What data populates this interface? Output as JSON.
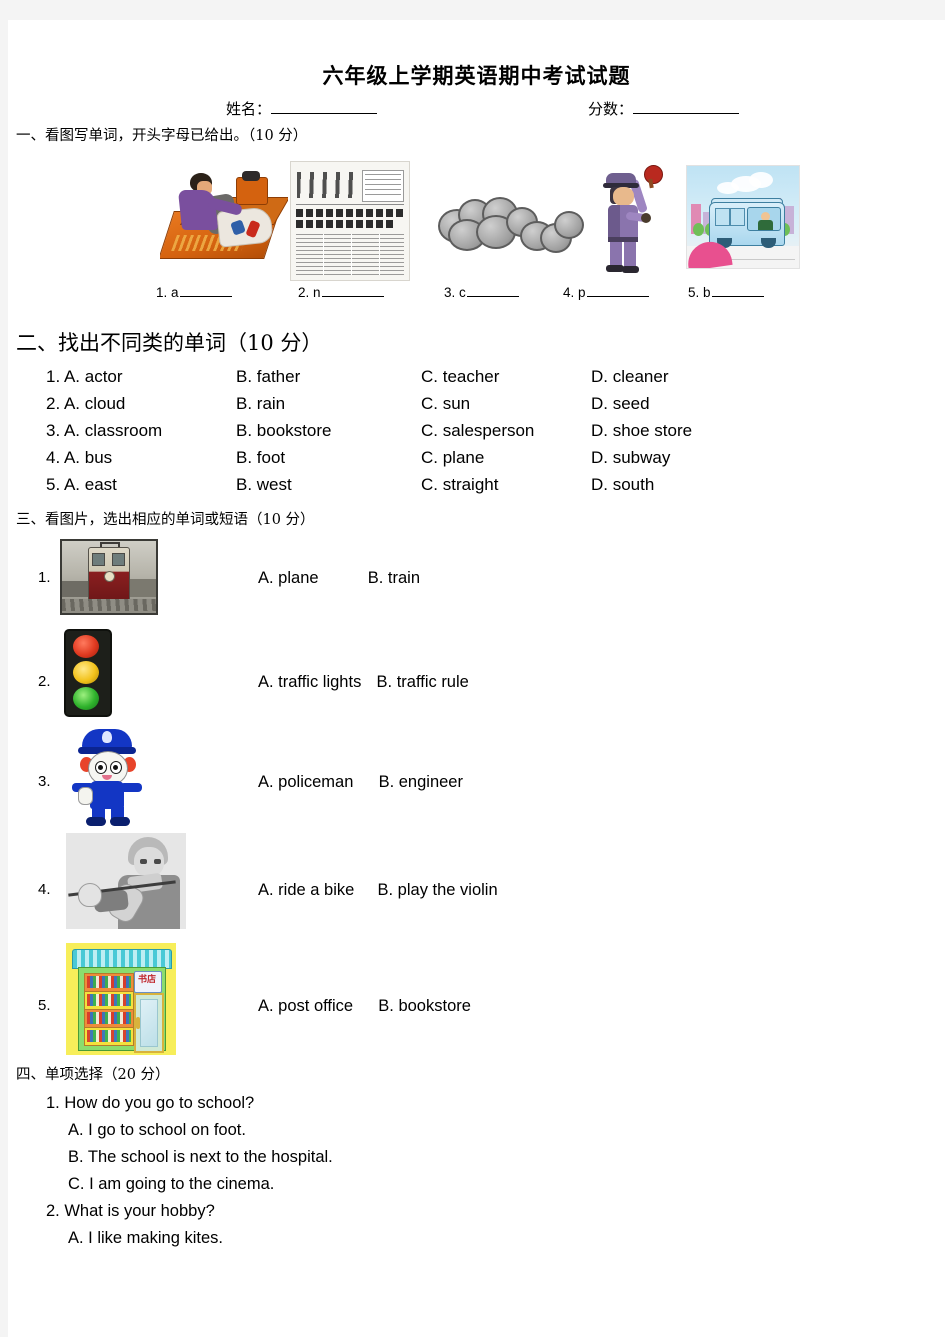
{
  "document": {
    "title": "六年级上学期英语期中考试试题",
    "name_label": "姓名：",
    "score_label": "分数："
  },
  "section1": {
    "heading": "一、看图写单词，开头字母已给出。（10 分）",
    "items": [
      {
        "num": "1.",
        "prefix": "a",
        "picture": "ambulance-picture"
      },
      {
        "num": "2.",
        "prefix": "n",
        "picture": "newspaper-picture"
      },
      {
        "num": "3.",
        "prefix": "c",
        "picture": "cloud-picture"
      },
      {
        "num": "4.",
        "prefix": "p",
        "picture": "policeman-picture"
      },
      {
        "num": "5.",
        "prefix": "b",
        "picture": "bus-picture"
      }
    ]
  },
  "section2": {
    "heading": "二、找出不同类的单词（10 分）",
    "rows": [
      {
        "a": "1. A. actor",
        "b": "B. father",
        "c": "C. teacher",
        "d": "D. cleaner"
      },
      {
        "a": "2. A. cloud",
        "b": "B. rain",
        "c": "C. sun",
        "d": "D. seed"
      },
      {
        "a": "3. A. classroom",
        "b": "B. bookstore",
        "c": "C. salesperson",
        "d": "D. shoe store"
      },
      {
        "a": "4. A. bus",
        "b": "B. foot",
        "c": "C. plane",
        "d": "D. subway"
      },
      {
        "a": "5. A. east",
        "b": "B. west",
        "c": "C. straight",
        "d": "D. south"
      }
    ]
  },
  "section3": {
    "heading": "三、看图片，选出相应的单词或短语（10 分）",
    "items": [
      {
        "num": "1.",
        "picture": "train-photo",
        "option_a": "A. plane",
        "option_b": "B. train"
      },
      {
        "num": "2.",
        "picture": "traffic-light-photo",
        "option_a": "A. traffic lights",
        "option_b": "B. traffic rule"
      },
      {
        "num": "3.",
        "picture": "policeman-mascot-photo",
        "option_a": "A. policeman",
        "option_b": "B. engineer"
      },
      {
        "num": "4.",
        "picture": "violin-player-photo",
        "option_a": "A. ride a bike",
        "option_b": "B. play the violin"
      },
      {
        "num": "5.",
        "picture": "bookstore-photo",
        "option_a": "A. post office",
        "option_b": "B. bookstore"
      }
    ]
  },
  "section4": {
    "heading": "四、单项选择（20 分）",
    "questions": [
      {
        "q": "1. How do you go to school?",
        "options": [
          "A. I go to school on foot.",
          "B. The school is next to the hospital.",
          "C. I am going to the cinema."
        ]
      },
      {
        "q": "2. What is your hobby?",
        "options": [
          "A. I like making kites."
        ]
      }
    ]
  },
  "store_sign_text": "书店"
}
